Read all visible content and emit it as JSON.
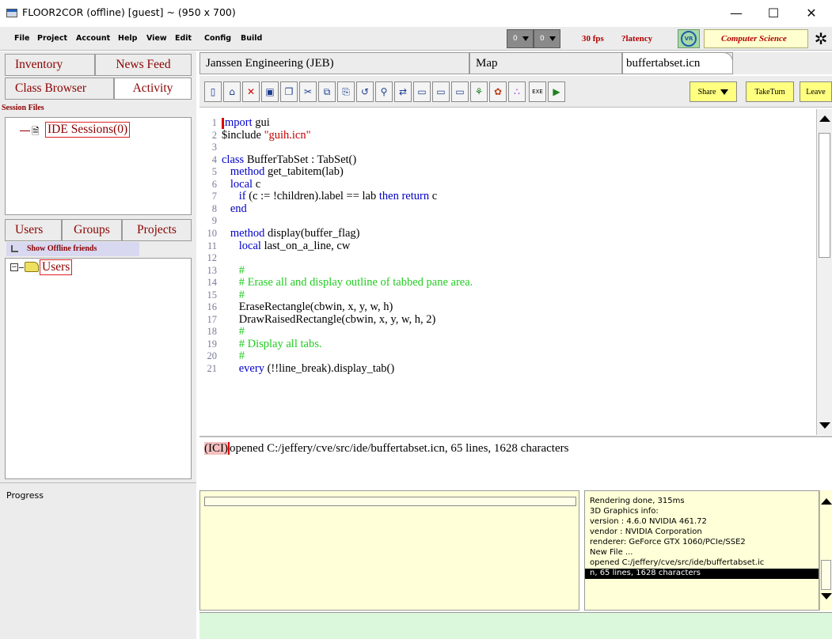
{
  "window": {
    "title": "FLOOR2COR (offline) [guest] ~ (950 x 700)",
    "minimize": "—",
    "maximize": "☐",
    "close": "✕"
  },
  "menubar": {
    "items": [
      "File",
      "Project",
      "Account",
      "Help",
      "View",
      "Edit",
      "Config",
      "Build"
    ],
    "dropdown_a": "0",
    "dropdown_b": "0",
    "fps": "30 fps",
    "latency": "?latency",
    "logo_text": "VR",
    "department": "Computer Science"
  },
  "left": {
    "tabs_top": [
      "Inventory",
      "News Feed",
      "Class Browser",
      "Activity"
    ],
    "session_files_label": "Session Files",
    "ide_sessions": "IDE Sessions(0)",
    "tabs_mid": [
      "Users",
      "Groups",
      "Projects"
    ],
    "show_offline": "Show Offline friends",
    "users_node": "Users",
    "progress_label": "Progress"
  },
  "editor": {
    "tabs": [
      "Janssen Engineering (JEB)",
      "Map",
      "buffertabset.icn"
    ],
    "toolbar_buttons": [
      "new-file",
      "open-folder",
      "delete",
      "save",
      "save-all",
      "cut",
      "copy",
      "paste",
      "undo",
      "find",
      "replace",
      "window-a",
      "window-b",
      "window-c",
      "tree",
      "palette",
      "dots",
      "exe",
      "run"
    ],
    "share_label": "Share",
    "take_turn_label": "TakeTurn",
    "leave_label": "Leave",
    "lines": [
      {
        "n": "1",
        "parts": [
          [
            "kw",
            "import"
          ],
          [
            "",
            " gui"
          ]
        ]
      },
      {
        "n": "2",
        "parts": [
          [
            "",
            "$include "
          ],
          [
            "str",
            "\"guih.icn\""
          ]
        ]
      },
      {
        "n": "3",
        "parts": []
      },
      {
        "n": "4",
        "parts": [
          [
            "kw",
            "class"
          ],
          [
            "",
            " BufferTabSet : TabSet()"
          ]
        ]
      },
      {
        "n": "5",
        "parts": [
          [
            "",
            "   "
          ],
          [
            "kw",
            "method"
          ],
          [
            "",
            " get_tabitem(lab)"
          ]
        ]
      },
      {
        "n": "6",
        "parts": [
          [
            "",
            "   "
          ],
          [
            "kw",
            "local"
          ],
          [
            "",
            " c"
          ]
        ]
      },
      {
        "n": "7",
        "parts": [
          [
            "",
            "      "
          ],
          [
            "kw",
            "if"
          ],
          [
            "",
            " (c := !children).label == lab "
          ],
          [
            "kw",
            "then"
          ],
          [
            "",
            " "
          ],
          [
            "kw",
            "return"
          ],
          [
            "",
            " c"
          ]
        ]
      },
      {
        "n": "8",
        "parts": [
          [
            "",
            "   "
          ],
          [
            "kw",
            "end"
          ]
        ]
      },
      {
        "n": "9",
        "parts": []
      },
      {
        "n": "10",
        "parts": [
          [
            "",
            "   "
          ],
          [
            "kw",
            "method"
          ],
          [
            "",
            " display(buffer_flag)"
          ]
        ]
      },
      {
        "n": "11",
        "parts": [
          [
            "",
            "      "
          ],
          [
            "kw",
            "local"
          ],
          [
            "",
            " last_on_a_line, cw"
          ]
        ]
      },
      {
        "n": "12",
        "parts": []
      },
      {
        "n": "13",
        "parts": [
          [
            "",
            "      "
          ],
          [
            "cm",
            "#"
          ]
        ]
      },
      {
        "n": "14",
        "parts": [
          [
            "",
            "      "
          ],
          [
            "cm",
            "# Erase all and display outline of tabbed pane area."
          ]
        ]
      },
      {
        "n": "15",
        "parts": [
          [
            "",
            "      "
          ],
          [
            "cm",
            "#"
          ]
        ]
      },
      {
        "n": "16",
        "parts": [
          [
            "",
            "      EraseRectangle(cbwin, x, y, w, h)"
          ]
        ]
      },
      {
        "n": "17",
        "parts": [
          [
            "",
            "      DrawRaisedRectangle(cbwin, x, y, w, h, 2)"
          ]
        ]
      },
      {
        "n": "18",
        "parts": [
          [
            "",
            "      "
          ],
          [
            "cm",
            "#"
          ]
        ]
      },
      {
        "n": "19",
        "parts": [
          [
            "",
            "      "
          ],
          [
            "cm",
            "# Display all tabs."
          ]
        ]
      },
      {
        "n": "20",
        "parts": [
          [
            "",
            "      "
          ],
          [
            "cm",
            "#"
          ]
        ]
      },
      {
        "n": "21",
        "parts": [
          [
            "",
            "      "
          ],
          [
            "kw",
            "every"
          ],
          [
            "",
            " (!!line_break).display_tab()"
          ]
        ]
      }
    ],
    "message_prefix": "(ICI)",
    "message": "opened C:/jeffery/cve/src/ide/buffertabset.icn, 65 lines, 1628 characters"
  },
  "console": {
    "lines": [
      "Rendering done, 315ms",
      "3D Graphics info:",
      "      version : 4.6.0 NVIDIA 461.72",
      "      vendor  : NVIDIA Corporation",
      "      renderer: GeForce GTX 1060/PCIe/SSE2",
      "New File ...",
      "opened C:/jeffery/cve/src/ide/buffertabset.ic",
      "n, 65 lines, 1628 characters"
    ]
  }
}
